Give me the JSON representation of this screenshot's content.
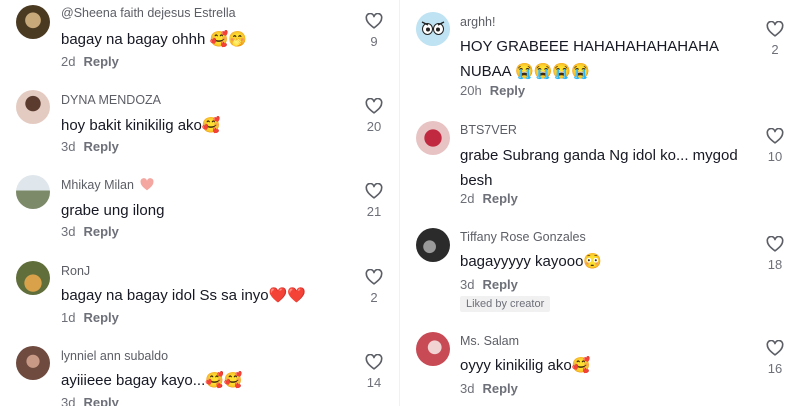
{
  "left_comments": [
    {
      "user": "@Sheena faith dejesus Estrella",
      "text": "bagay na bagay ohhh 🥰🤭",
      "time": "2d",
      "reply": "Reply",
      "likes": "9",
      "avatar_color": "#5a4a33"
    },
    {
      "user": "DYNA MENDOZA",
      "text": "hoy bakit kinikilig ako🥰",
      "time": "3d",
      "reply": "Reply",
      "likes": "20",
      "avatar_color": "#c9a69a"
    },
    {
      "user": "Mhikay Milan",
      "text": "grabe ung ilong",
      "time": "3d",
      "reply": "Reply",
      "likes": "21",
      "avatar_color": "#8d9aa6"
    },
    {
      "user": "RonJ",
      "text": "bagay na bagay idol Ss sa inyo❤️❤️",
      "time": "1d",
      "reply": "Reply",
      "likes": "2",
      "avatar_color": "#5f6e3a"
    },
    {
      "user": "lynniel ann subaldo",
      "text": "ayiiieee bagay kayo...🥰🥰",
      "time": "3d",
      "reply": "Reply",
      "likes": "14",
      "avatar_color": "#9b6b5b"
    }
  ],
  "right_comments": [
    {
      "user": "arghh!",
      "text": "HOY GRABEEE HAHAHAHAHAHAHA\nNUBAA 😭😭😭😭",
      "time": "20h",
      "reply": "Reply",
      "likes": "2",
      "avatar_color": "#bfe3f2"
    },
    {
      "user": "BTS7VER",
      "text": "grabe Subrang ganda Ng idol ko... mygod\nbesh",
      "time": "2d",
      "reply": "Reply",
      "likes": "10",
      "avatar_color": "#d8a7a7"
    },
    {
      "user": "Tiffany Rose Gonzales",
      "text": "bagayyyyy kayooo😳",
      "time": "3d",
      "reply": "Reply",
      "likes": "18",
      "badge": "Liked by creator",
      "avatar_color": "#3a3a3a"
    },
    {
      "user": "Ms. Salam",
      "text": "oyyy kinikilig ako🥰",
      "time": "3d",
      "reply": "Reply",
      "likes": "16",
      "avatar_color": "#c74a55"
    }
  ],
  "colors": {
    "heart_outline": "#5c5e66",
    "meta": "#6e7079",
    "badge_bg": "#f1f1f2",
    "pink_heart": "#f4a7a0"
  },
  "icons": {
    "like": "heart-outline-icon",
    "name_heart": "pink-heart-icon"
  }
}
